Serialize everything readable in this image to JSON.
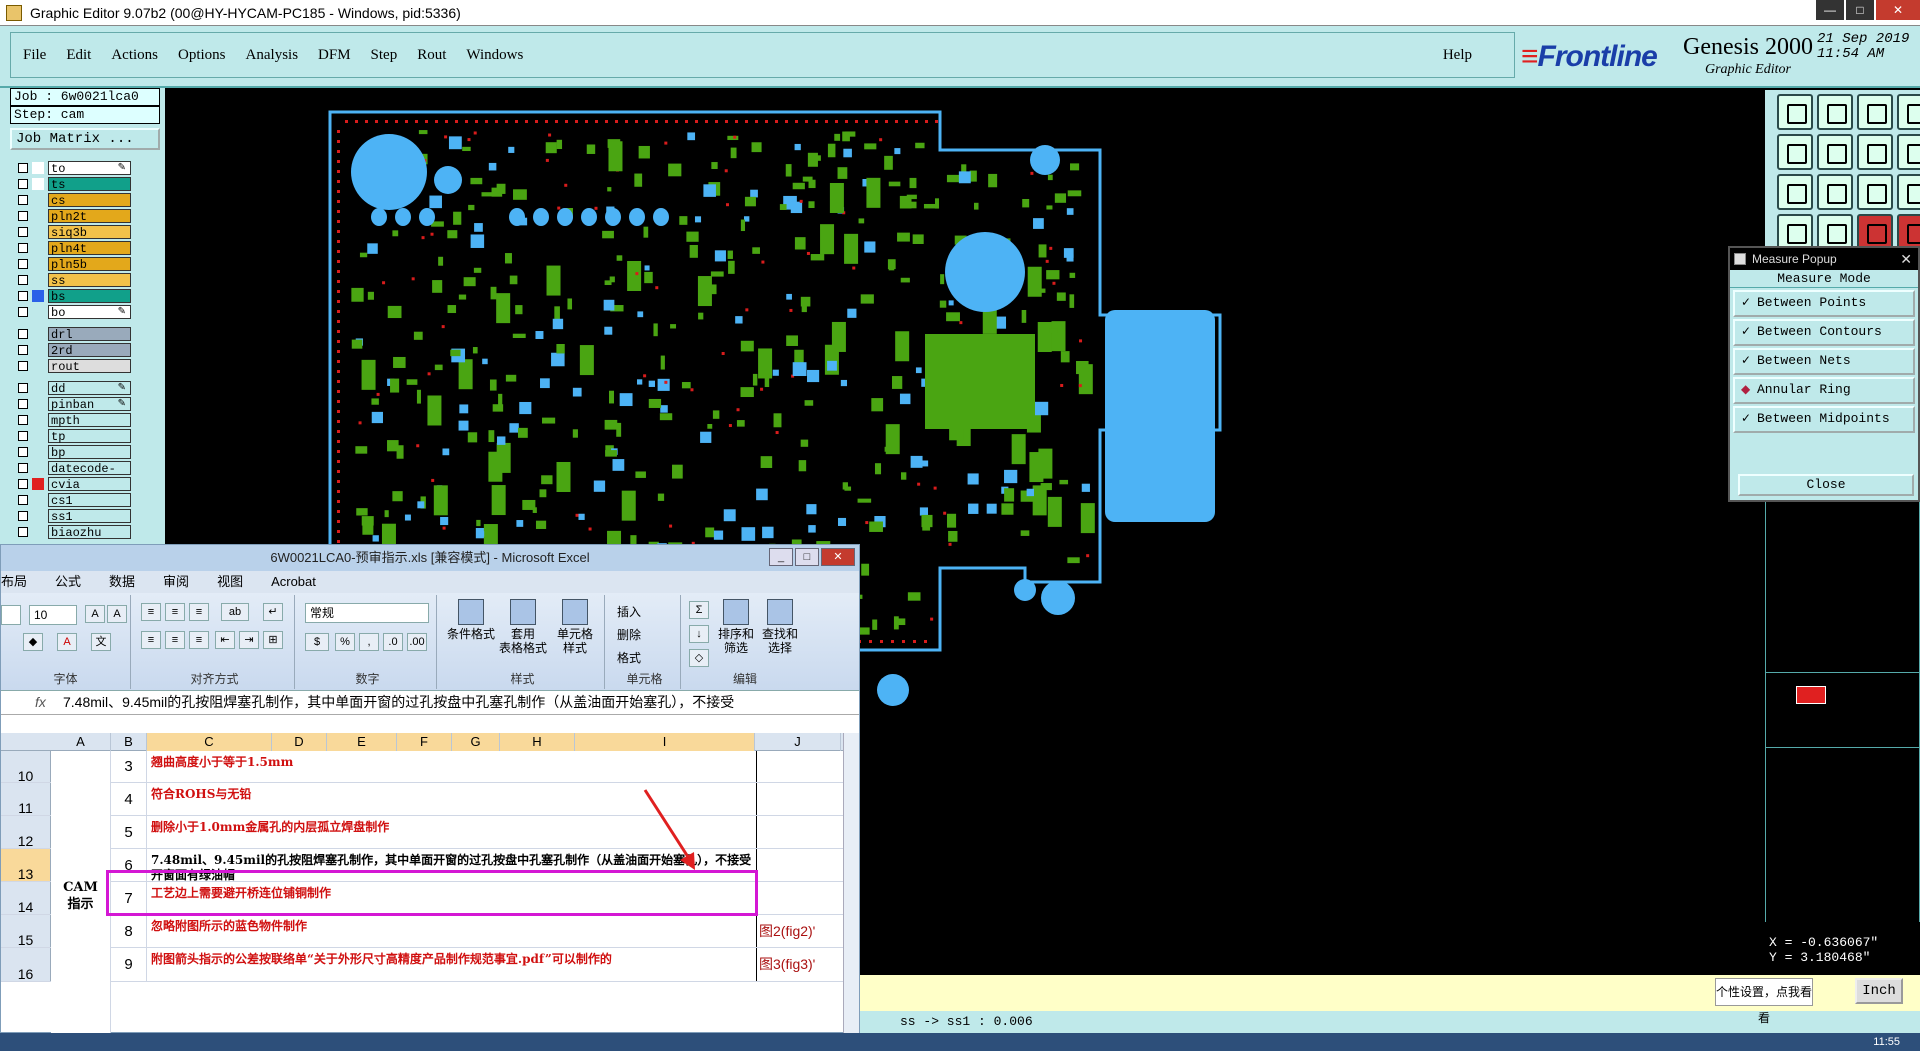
{
  "window": {
    "title": "Graphic Editor 9.07b2 (00@HY-HYCAM-PC185 - Windows, pid:5336)"
  },
  "menu": {
    "items": [
      "File",
      "Edit",
      "Actions",
      "Options",
      "Analysis",
      "DFM",
      "Step",
      "Rout",
      "Windows"
    ],
    "help": "Help"
  },
  "brand": {
    "logo": "Frontline",
    "product": "Genesis 2000",
    "subtitle": "Graphic Editor",
    "date": "21 Sep 2019",
    "time": "11:54 AM"
  },
  "job": {
    "job_label": "Job : 6w0021lca0",
    "step_label": "Step: cam",
    "matrix_button": "Job Matrix ..."
  },
  "layers": [
    {
      "name": "to",
      "color": "#ffffff",
      "sq": "#ffffff",
      "edit": true
    },
    {
      "name": "ts",
      "color": "#11a08a",
      "sq": "#ffffff",
      "edit": false
    },
    {
      "name": "cs",
      "color": "#e3a81b",
      "sq": "",
      "edit": false
    },
    {
      "name": "pln2t",
      "color": "#e3a81b",
      "sq": "",
      "edit": false
    },
    {
      "name": "siq3b",
      "color": "#f2c24a",
      "sq": "",
      "edit": false
    },
    {
      "name": "pln4t",
      "color": "#e3a81b",
      "sq": "",
      "edit": false
    },
    {
      "name": "pln5b",
      "color": "#e3a81b",
      "sq": "",
      "edit": false
    },
    {
      "name": "ss",
      "color": "#f2c24a",
      "sq": "",
      "edit": false
    },
    {
      "name": "bs",
      "color": "#11a08a",
      "sq": "#2b60e8",
      "edit": false
    },
    {
      "name": "bo",
      "color": "#ffffff",
      "sq": "",
      "edit": true
    },
    {
      "name": "drl",
      "color": "#9ab",
      "sq": "",
      "edit": false,
      "gap": true
    },
    {
      "name": "2rd",
      "color": "#9ab",
      "sq": "",
      "edit": false
    },
    {
      "name": "rout",
      "color": "#ddd",
      "sq": "",
      "edit": false
    },
    {
      "name": "dd",
      "color": "#bfe9ea",
      "sq": "",
      "edit": true,
      "gap": true
    },
    {
      "name": "pinban",
      "color": "#bfe9ea",
      "sq": "",
      "edit": true
    },
    {
      "name": "mpth",
      "color": "#bfe9ea",
      "sq": "",
      "edit": false
    },
    {
      "name": "tp",
      "color": "#bfe9ea",
      "sq": "",
      "edit": false
    },
    {
      "name": "bp",
      "color": "#bfe9ea",
      "sq": "",
      "edit": false
    },
    {
      "name": "datecode-pt",
      "color": "#bfe9ea",
      "sq": "",
      "edit": false
    },
    {
      "name": "cvia",
      "color": "#bfe9ea",
      "sq": "#e02020",
      "edit": false
    },
    {
      "name": "cs1",
      "color": "#bfe9ea",
      "sq": "",
      "edit": false
    },
    {
      "name": "ss1",
      "color": "#bfe9ea",
      "sq": "",
      "edit": false
    },
    {
      "name": "biaozhu",
      "color": "#bfe9ea",
      "sq": "",
      "edit": false
    }
  ],
  "measure": {
    "title": "Measure Popup",
    "header": "Measure Mode",
    "options": [
      "Between Points",
      "Between Contours",
      "Between Nets",
      "Annular Ring",
      "Between Midpoints"
    ],
    "selected": "Annular Ring",
    "close": "Close"
  },
  "coords": {
    "x": "X = -0.636067\"",
    "y": "Y = 3.180468\""
  },
  "status": {
    "text": "ss -> ss1 : 0.006",
    "units": "Inch",
    "tooltip": "个性设置，点我看看"
  },
  "excel": {
    "title": "6W0021LCA0-预审指示.xls  [兼容模式] - Microsoft Excel",
    "tabs": [
      "布局",
      "公式",
      "数据",
      "审阅",
      "视图",
      "Acrobat"
    ],
    "font_size": "10",
    "number_format": "常规",
    "groups": [
      "字体",
      "对齐方式",
      "数字",
      "样式",
      "单元格",
      "编辑"
    ],
    "style_buttons": [
      "条件格式",
      "套用\n表格格式",
      "单元格\n样式"
    ],
    "cell_buttons": [
      "插入",
      "删除",
      "格式"
    ],
    "edit_buttons": [
      "排序和\n筛选",
      "查找和\n选择"
    ],
    "formula": "7.48mil、9.45mil的孔按阻焊塞孔制作，其中单面开窗的过孔按盘中孔塞孔制作（从盖油面开始塞孔），不接受",
    "fx": "fx",
    "columns": [
      "A",
      "B",
      "C",
      "D",
      "E",
      "F",
      "G",
      "H",
      "I",
      "J"
    ],
    "merged_label": "CAM\n指示",
    "rows": [
      {
        "num": "10",
        "b": "3",
        "c": "翘曲高度小于等于1.5mm",
        "j": "",
        "black": false
      },
      {
        "num": "11",
        "b": "4",
        "c": "符合ROHS与无铅",
        "j": "",
        "black": false
      },
      {
        "num": "12",
        "b": "5",
        "c": "删除小于1.0mm金属孔的内层孤立焊盘制作",
        "j": "",
        "black": false
      },
      {
        "num": "13",
        "b": "6",
        "c": "7.48mil、9.45mil的孔按阻焊塞孔制作，其中单面开窗的过孔按盘中孔塞孔制作（从盖油面开始塞孔），不接受开窗面有绿油帽",
        "j": "",
        "black": true
      },
      {
        "num": "14",
        "b": "7",
        "c": "工艺边上需要避开桥连位铺铜制作",
        "j": "",
        "black": false
      },
      {
        "num": "15",
        "b": "8",
        "c": "忽略附图所示的蓝色物件制作",
        "j": "图2(fig2)'",
        "black": false
      },
      {
        "num": "16",
        "b": "9",
        "c": "附图箭头指示的公差按联络单“关于外形尺寸高精度产品制作规范事宜.pdf”可以制作的",
        "j": "图3(fig3)'",
        "black": false
      }
    ]
  },
  "taskbar": {
    "time": "11:55"
  },
  "colors": {
    "pad_green": "#4aa512",
    "pad_blue": "#4db3f5",
    "via_red": "#d81c1c",
    "panel": "#bfe9ea"
  }
}
